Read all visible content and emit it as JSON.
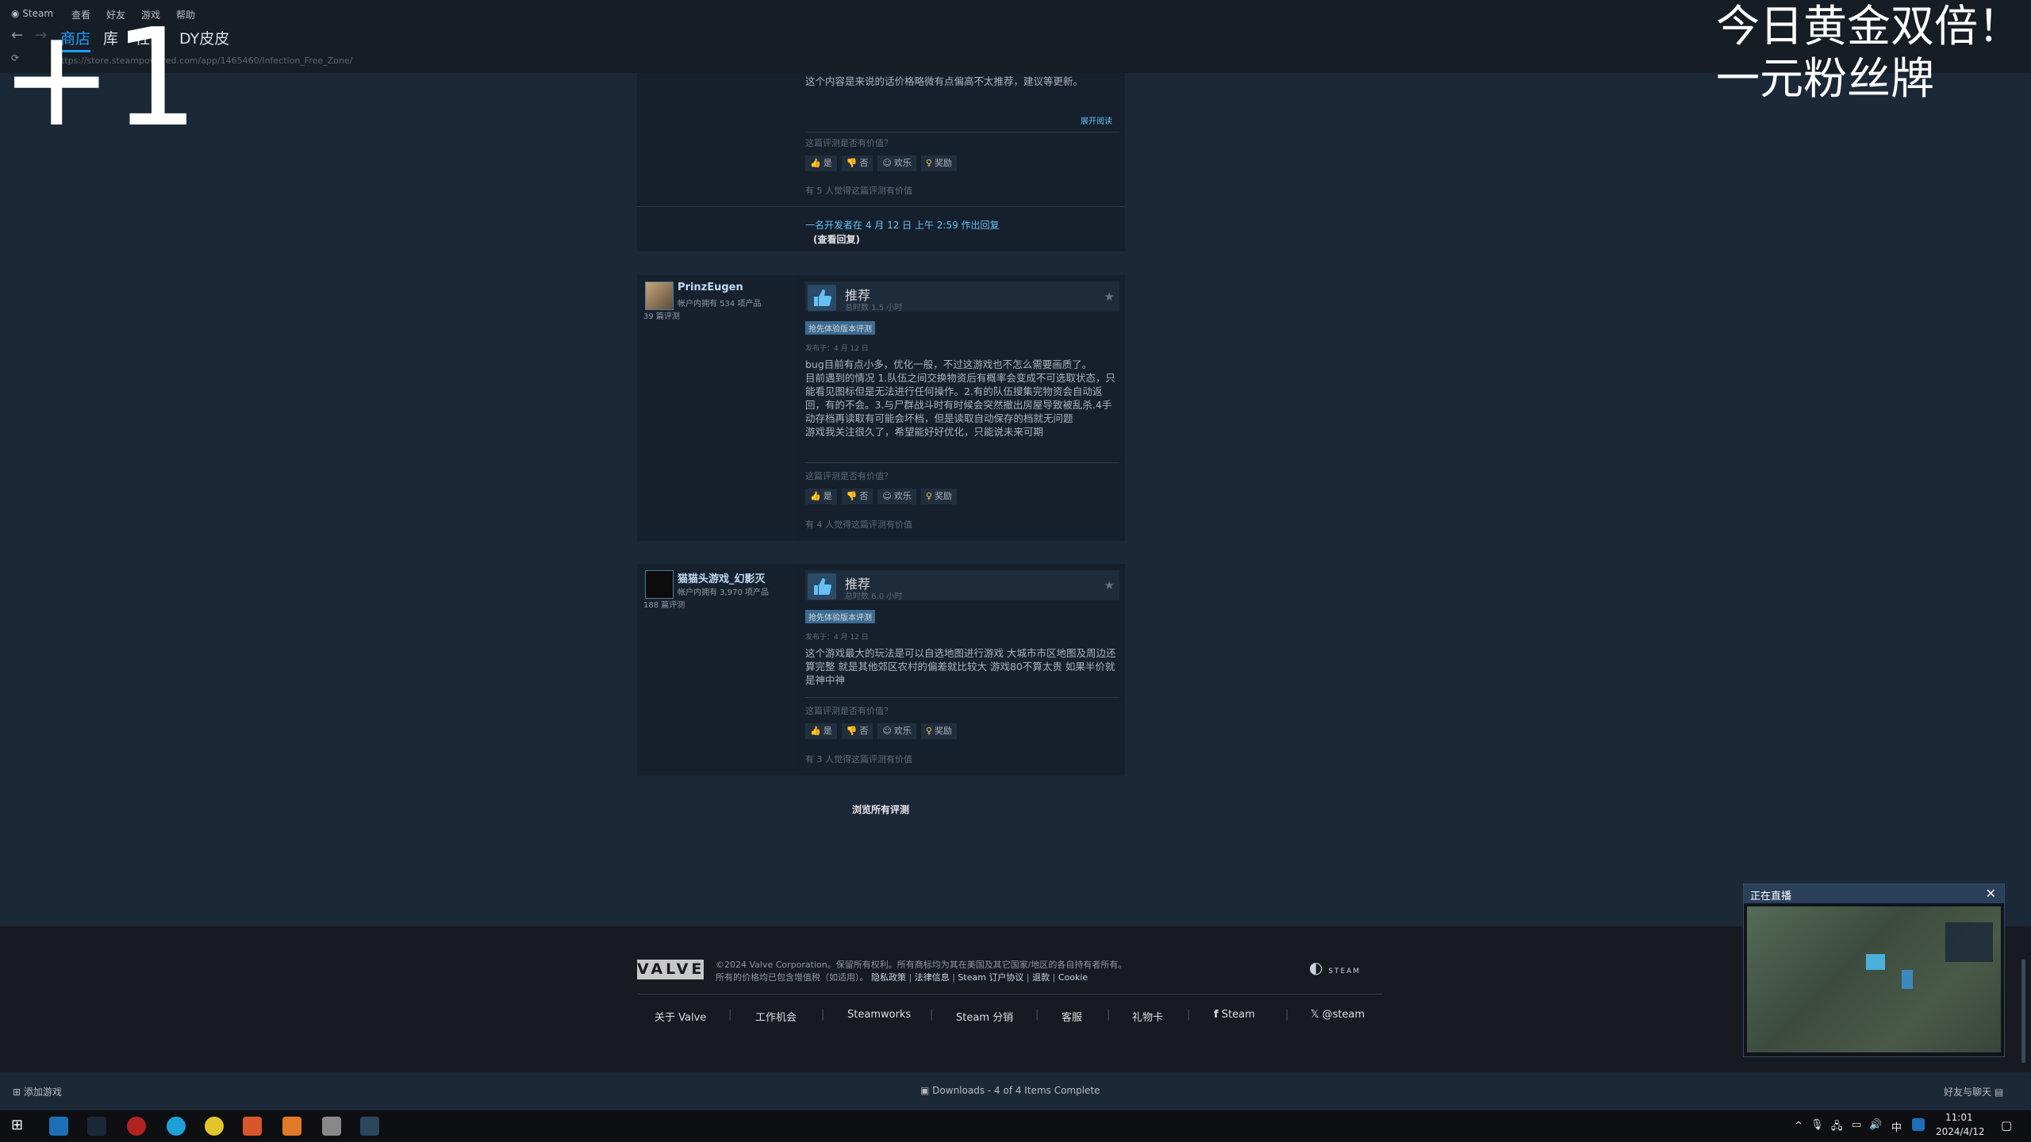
{
  "app": {
    "menu": [
      "Steam",
      "查看",
      "好友",
      "游戏",
      "帮助"
    ],
    "nav_tabs": [
      "商店",
      "库",
      "社区",
      "DY皮皮"
    ],
    "url": "https://store.steampowered.com/app/1465460/Infection_Free_Zone/"
  },
  "overlay": {
    "plus_one": "+1",
    "promo_line1": "今日黄金双倍！",
    "promo_line2": "一元粉丝牌"
  },
  "top_review": {
    "text_tail": "这个内容是来说的话价格略微有点偏高不太推荐，建议等更新。",
    "expand": "展开阅读",
    "helpful_question": "这篇评测是否有价值？",
    "votes": [
      "是",
      "否",
      "欢乐",
      "奖励"
    ],
    "helpful_count": "有 5 人觉得这篇评测有价值",
    "dev_reply": "一名开发者在 4 月 12 日 上午 2:59 作出回复",
    "dev_reply_view": "(查看回复)"
  },
  "reviews": [
    {
      "username": "PrinzEugen",
      "owned": "帐户内拥有 534 项产品",
      "review_count": "39 篇评测",
      "recommendation": "推荐",
      "hours": "总时数 1.5 小时",
      "badge": "抢先体验版本评测",
      "posted": "发布于：4 月 12 日",
      "body": "bug目前有点小多，优化一般，不过这游戏也不怎么需要画质了。\n目前遇到的情况 1.队伍之间交换物资后有概率会变成不可选取状态，只能看见图标但是无法进行任何操作。2.有的队伍搜集完物资会自动返回，有的不会。3.与尸群战斗时有时候会突然撤出房屋导致被乱杀.4手动存档再读取有可能会坏档，但是读取自动保存的档就无问题\n游戏我关注很久了，希望能好好优化，只能说未来可期",
      "helpful_question": "这篇评测是否有价值？",
      "votes": [
        "是",
        "否",
        "欢乐",
        "奖励"
      ],
      "helpful_count": "有 4 人觉得这篇评测有价值"
    },
    {
      "username": "猫猫头游戏_幻影灭",
      "owned": "帐户内拥有 3,970 项产品",
      "review_count": "188 篇评测",
      "recommendation": "推荐",
      "hours": "总时数 6.0 小时",
      "badge": "抢先体验版本评测",
      "posted": "发布于：4 月 12 日",
      "body": "这个游戏最大的玩法是可以自选地图进行游戏 大城市市区地图及周边还算完整 就是其他郊区农村的偏差就比较大 游戏80不算太贵 如果半价就是神中神",
      "helpful_question": "这篇评测是否有价值？",
      "votes": [
        "是",
        "否",
        "欢乐",
        "奖励"
      ],
      "helpful_count": "有 3 人觉得这篇评测有价值"
    }
  ],
  "browse_all": "浏览所有评测",
  "footer": {
    "valve": "VALVE",
    "copyright": "©2024 Valve Corporation。保留所有权利。所有商标均为其在美国及其它国家/地区的各自持有者所有。",
    "vat": "所有的价格均已包含增值税（如适用）。",
    "legal_links": [
      "隐私政策",
      "法律信息",
      "Steam 订户协议",
      "退款",
      "Cookie"
    ],
    "steam_logo_text": "STEAM",
    "links": [
      "关于 Valve",
      "工作机会",
      "Steamworks",
      "Steam 分销",
      "客服",
      "礼物卡",
      "Steam",
      "@steam"
    ]
  },
  "statusbar": {
    "add_game": "添加游戏",
    "downloads": "Downloads - 4 of 4 Items Complete",
    "friends": "好友与聊天"
  },
  "live_preview": {
    "title": "正在直播"
  },
  "taskbar": {
    "time": "11:01",
    "date": "2024/4/12",
    "ime": "中"
  }
}
